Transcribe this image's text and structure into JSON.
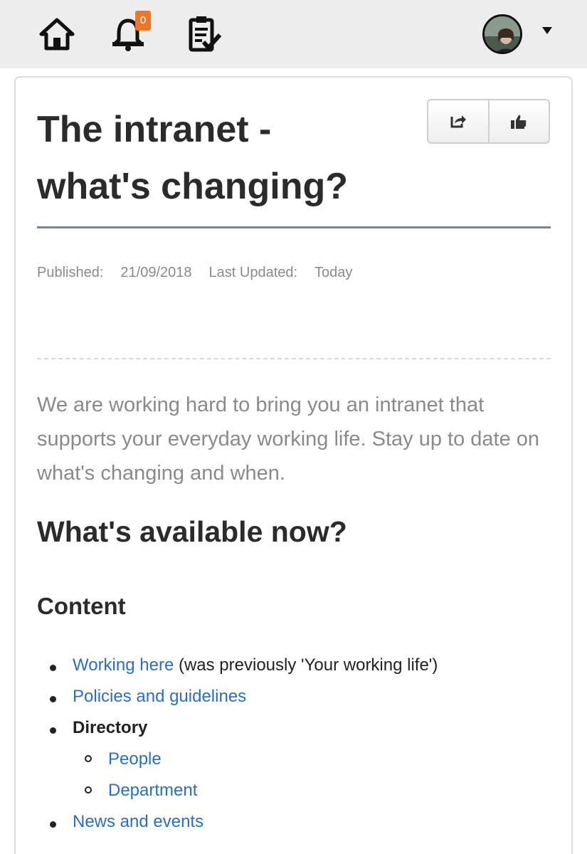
{
  "nav": {
    "notification_count": "0",
    "icons": [
      "home-icon",
      "bell-icon",
      "clipboard-check-icon",
      "avatar",
      "chevron-down-icon"
    ]
  },
  "article": {
    "title_line1": "The intranet -",
    "title_line2": "what's changing?",
    "published_label": "Published:",
    "published_date": "21/09/2018",
    "updated_label": "Last Updated:",
    "updated_value": "Today",
    "intro": "We are working hard to bring you an intranet that supports your everyday working life. Stay up to date on what's changing and when.",
    "section_heading": "What's available now?",
    "subsection_heading": "Content",
    "list": {
      "item1_link": "Working here",
      "item1_note": " (was previously 'Your working life')",
      "item2_link": "Policies and guidelines",
      "item3_label": "Directory",
      "item3_sub1": "People",
      "item3_sub2": "Department",
      "item4_link": "News and events"
    }
  },
  "actions": {
    "share_icon": "share-icon",
    "like_icon": "thumbs-up-icon"
  },
  "colors": {
    "link": "#2a6fbd",
    "badge": "#e8782a",
    "rule": "#7a8591",
    "topbar": "#ededed"
  }
}
